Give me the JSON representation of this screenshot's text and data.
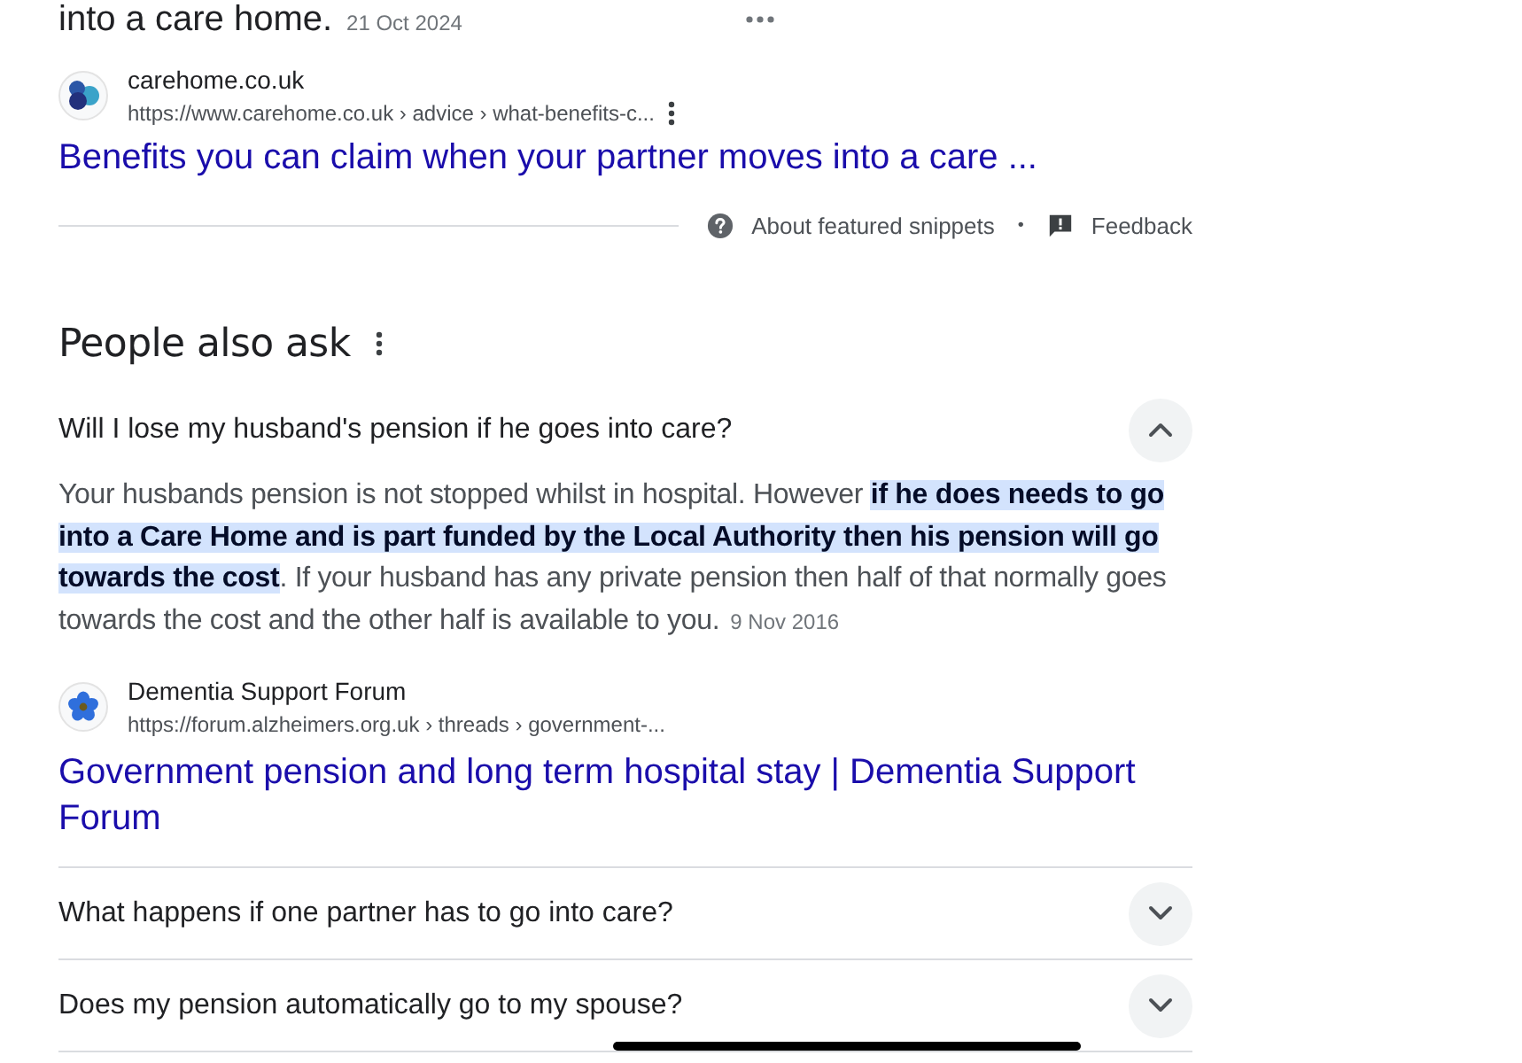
{
  "top_result": {
    "snippet_tail": "into a care home.",
    "date": "21 Oct 2024",
    "source": {
      "site": "carehome.co.uk",
      "url": "https://www.carehome.co.uk › advice › what-benefits-c..."
    },
    "title": "Benefits you can claim when your partner moves into a care ..."
  },
  "snippet_footer": {
    "about": "About featured snippets",
    "separator": "•",
    "feedback": "Feedback"
  },
  "people_also_ask": {
    "heading": "People also ask",
    "questions": [
      {
        "question": "Will I lose my husband's pension if he goes into care?",
        "expanded": true,
        "answer": "Your husbands pension is not stopped whilst in hospital. However **if he does needs to go into a Care Home and is part funded by the Local Authority then his pension will go towards the cost**. If your husband has any private pension then half of that normally goes towards the cost and the other half is available to you.",
        "date": "9 Nov 2016",
        "source": {
          "site": "Dementia Support Forum",
          "url": "https://forum.alzheimers.org.uk › threads › government-..."
        },
        "title": "Government pension and long term hospital stay | Dementia Support Forum"
      },
      {
        "question": "What happens if one partner has to go into care?",
        "expanded": false
      },
      {
        "question": "Does my pension automatically go to my spouse?",
        "expanded": false
      }
    ]
  }
}
